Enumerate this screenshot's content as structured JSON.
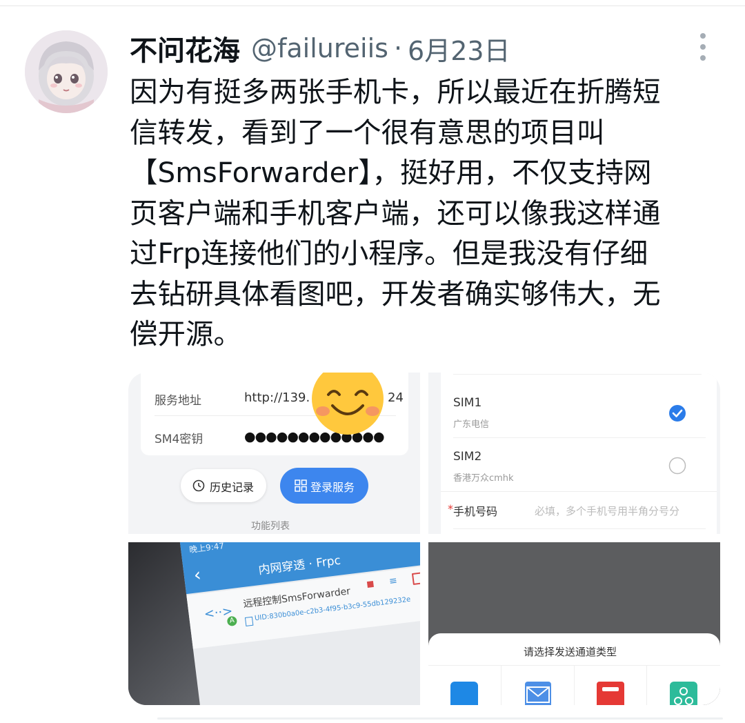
{
  "tweet": {
    "display_name": "不问花海",
    "handle": "@failureiis",
    "separator": "·",
    "date": "6月23日",
    "text": "因为有挺多两张手机卡，所以最近在折腾短\n信转发，看到了一个很有意思的项目叫\n【SmsForwarder】，挺好用，不仅支持网\n页客户端和手机客户端，还可以像我这样通\n过Frp连接他们的小程序。但是我没有仔细\n去钻研具体看图吧，开发者确实够伟大，无\n偿开源。"
  },
  "media": {
    "tile1": {
      "server_label": "服务地址",
      "server_value": "http://139.",
      "server_value_tail": "24",
      "key_label": "SM4密钥",
      "key_value": "●●●●●●●●●●●●●",
      "history_button": "历史记录",
      "login_button": "登录服务",
      "footer_label": "功能列表"
    },
    "tile2": {
      "sim1_label": "SIM1",
      "sim1_carrier": "广东电信",
      "sim2_label": "SIM2",
      "sim2_carrier": "香港万众cmhk",
      "required_mark": "*",
      "phone_label": "手机号码",
      "phone_placeholder": "必填，多个手机号用半角分号分"
    },
    "tile3": {
      "status_text": "晚上9:47",
      "title": "内网穿透 · Frpc",
      "item_title": "远程控制SmsForwarder",
      "item_uid": "UID:830b0a0e-c2b3-4f95-b3c9-55db129232e",
      "badge": "A"
    },
    "tile4": {
      "sheet_title": "请选择发送通道类型"
    }
  },
  "colors": {
    "text_primary": "#0f1419",
    "text_secondary": "#536471",
    "blue_button": "#3d86ee",
    "checkbox_blue": "#2b7ce9",
    "frpc_header": "#3a8ed6"
  },
  "icons": [
    "more-vertical-icon",
    "clock-icon",
    "grid-icon",
    "checkmark-icon",
    "back-arrow-icon",
    "link-nodes-icon",
    "copy-icon",
    "stop-icon",
    "sort-icon",
    "trash-icon",
    "dingtalk-icon",
    "email-icon",
    "bark-icon",
    "webhook-icon",
    "smiley-emoji"
  ]
}
